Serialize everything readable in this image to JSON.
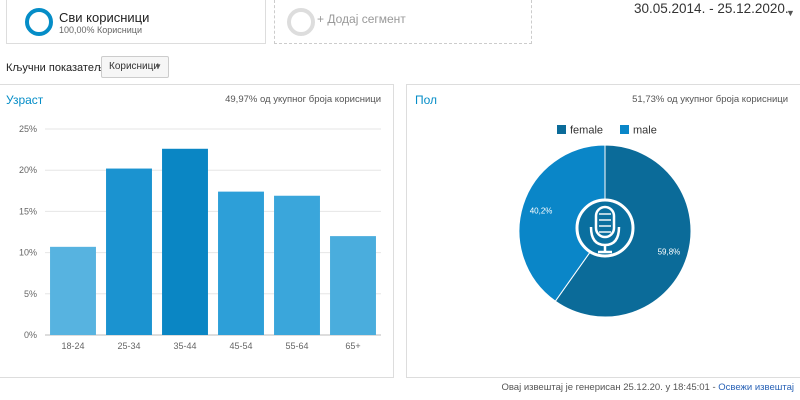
{
  "segments": {
    "all_users": {
      "title": "Сви корисници",
      "subtitle": "100,00% Корисници"
    },
    "add_segment": {
      "label": "+ Додај сегмент"
    }
  },
  "date_range": "30.05.2014. - 25.12.2020.",
  "metric": {
    "label": "Кључни показатељ:",
    "selected": "Корисници"
  },
  "age_panel": {
    "title": "Узраст",
    "percent_of_total": "49,97% од укупног броја корисници"
  },
  "gender_panel": {
    "title": "Пол",
    "percent_of_total": "51,73% од укупног броја корисници"
  },
  "chart_data": [
    {
      "type": "bar",
      "categories": [
        "18-24",
        "25-34",
        "35-44",
        "45-54",
        "55-64",
        "65+"
      ],
      "values": [
        10.7,
        20.2,
        22.6,
        17.4,
        16.9,
        12.0
      ],
      "y_ticks": [
        "0%",
        "5%",
        "10%",
        "15%",
        "20%",
        "25%"
      ],
      "ylim": [
        0,
        25
      ],
      "grid": true,
      "colors": [
        "#57b3e0",
        "#1b93d0",
        "#0a86c4",
        "#2d9fd8",
        "#3aa6db",
        "#4aaddd"
      ]
    },
    {
      "type": "pie",
      "labels": [
        "female",
        "male"
      ],
      "values": [
        59.8,
        40.2
      ],
      "value_labels": [
        "59,8%",
        "40,2%"
      ],
      "colors": [
        "#0b6b99",
        "#0a86c8"
      ],
      "legend": "top"
    }
  ],
  "footer": {
    "text": "Овај извештај је генерисан 25.12.20. у 18:45:01 - ",
    "refresh_link": "Освежи извештај"
  }
}
